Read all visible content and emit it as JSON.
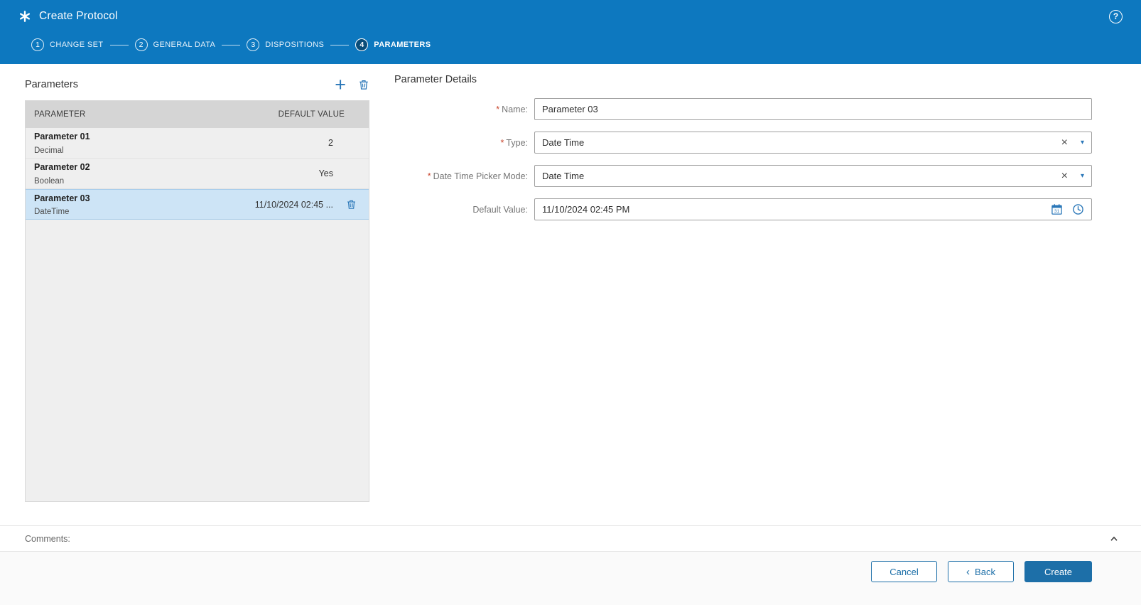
{
  "colors": {
    "header_blue": "#0d78bf",
    "primary_blue": "#1d6fa8",
    "icon_blue": "#2a77b8",
    "selected_row_bg": "#cde4f6",
    "required_marker_color": "#c9472f",
    "table_header_bg": "#d5d5d5",
    "list_bg": "#efefef"
  },
  "icons": {
    "app": "asterisk-icon",
    "help_glyph": "?",
    "add_glyph": "+",
    "delete": "trash-icon",
    "clear_glyph": "×",
    "caret_glyph": "▾",
    "calendar": "calendar-icon",
    "clock": "clock-icon",
    "collapse": "chevron-up-icon",
    "back_glyph": "‹"
  },
  "header": {
    "title": "Create Protocol",
    "steps": [
      {
        "num": "1",
        "label": "CHANGE SET"
      },
      {
        "num": "2",
        "label": "GENERAL DATA"
      },
      {
        "num": "3",
        "label": "DISPOSITIONS"
      },
      {
        "num": "4",
        "label": "PARAMETERS"
      }
    ]
  },
  "parameters_panel": {
    "title": "Parameters",
    "columns": {
      "parameter": "PARAMETER",
      "default_value": "DEFAULT VALUE"
    },
    "rows": [
      {
        "name": "Parameter 01",
        "type": "Decimal",
        "default_value": "2"
      },
      {
        "name": "Parameter 02",
        "type": "Boolean",
        "default_value": "Yes"
      },
      {
        "name": "Parameter 03",
        "type": "DateTime",
        "default_value": "11/10/2024 02:45 ..."
      }
    ]
  },
  "details_panel": {
    "title": "Parameter Details",
    "required_marker": "*",
    "fields": {
      "name": {
        "label": "Name:",
        "value": "Parameter 03"
      },
      "type": {
        "label": "Type:",
        "value": "Date Time"
      },
      "picker_mode": {
        "label": "Date Time Picker Mode:",
        "value": "Date Time"
      },
      "default_value": {
        "label": "Default Value:",
        "value": "11/10/2024 02:45 PM"
      }
    }
  },
  "comments": {
    "label": "Comments:"
  },
  "footer": {
    "cancel_label": "Cancel",
    "back_label": "Back",
    "create_label": "Create"
  }
}
